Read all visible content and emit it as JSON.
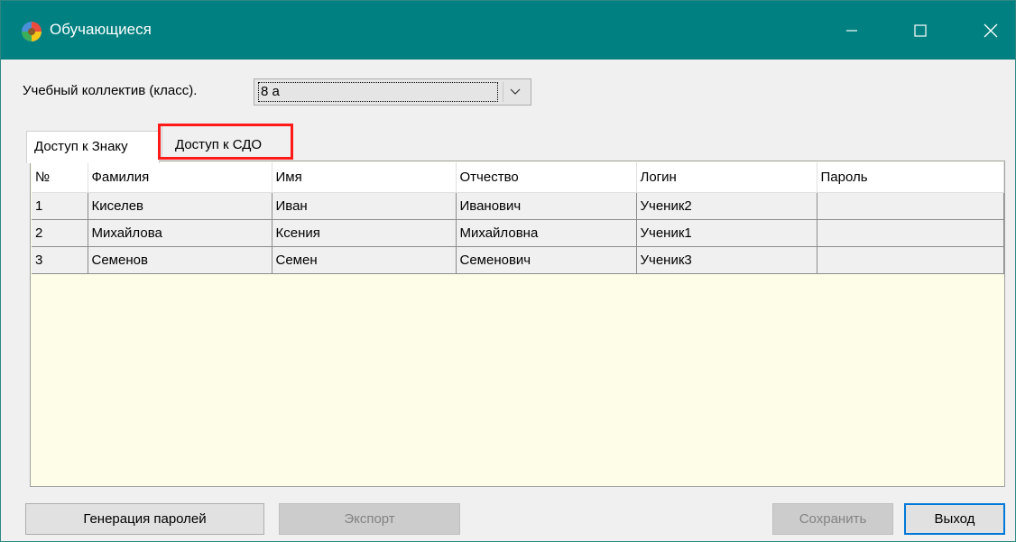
{
  "window": {
    "title": "Обучающиеся",
    "controls": {
      "minimize_icon": "minimize-icon",
      "maximize_icon": "maximize-icon",
      "close_icon": "close-icon"
    },
    "titlebar_color": "#008080"
  },
  "class_selector": {
    "label": "Учебный коллектив (класс).",
    "value": "8 а"
  },
  "tabs": [
    {
      "label": "Доступ к Знаку",
      "active": true
    },
    {
      "label": "Доступ к СДО",
      "active": false,
      "highlighted": true
    }
  ],
  "table": {
    "columns": [
      "№",
      "Фамилия",
      "Имя",
      "Отчество",
      "Логин",
      "Пароль"
    ],
    "rows": [
      [
        "1",
        "Киселев",
        "Иван",
        "Иванович",
        "Ученик2",
        ""
      ],
      [
        "2",
        "Михайлова",
        "Ксения",
        "Михайловна",
        "Ученик1",
        ""
      ],
      [
        "3",
        "Семенов",
        "Семен",
        "Семенович",
        "Ученик3",
        ""
      ]
    ]
  },
  "footer": {
    "buttons": {
      "generate": "Генерация паролей",
      "export": "Экспорт",
      "save": "Сохранить",
      "exit": "Выход"
    }
  },
  "colors": {
    "highlight": "#ff1a1a",
    "table_background": "#fefde8",
    "focus_border": "#0078d7"
  }
}
